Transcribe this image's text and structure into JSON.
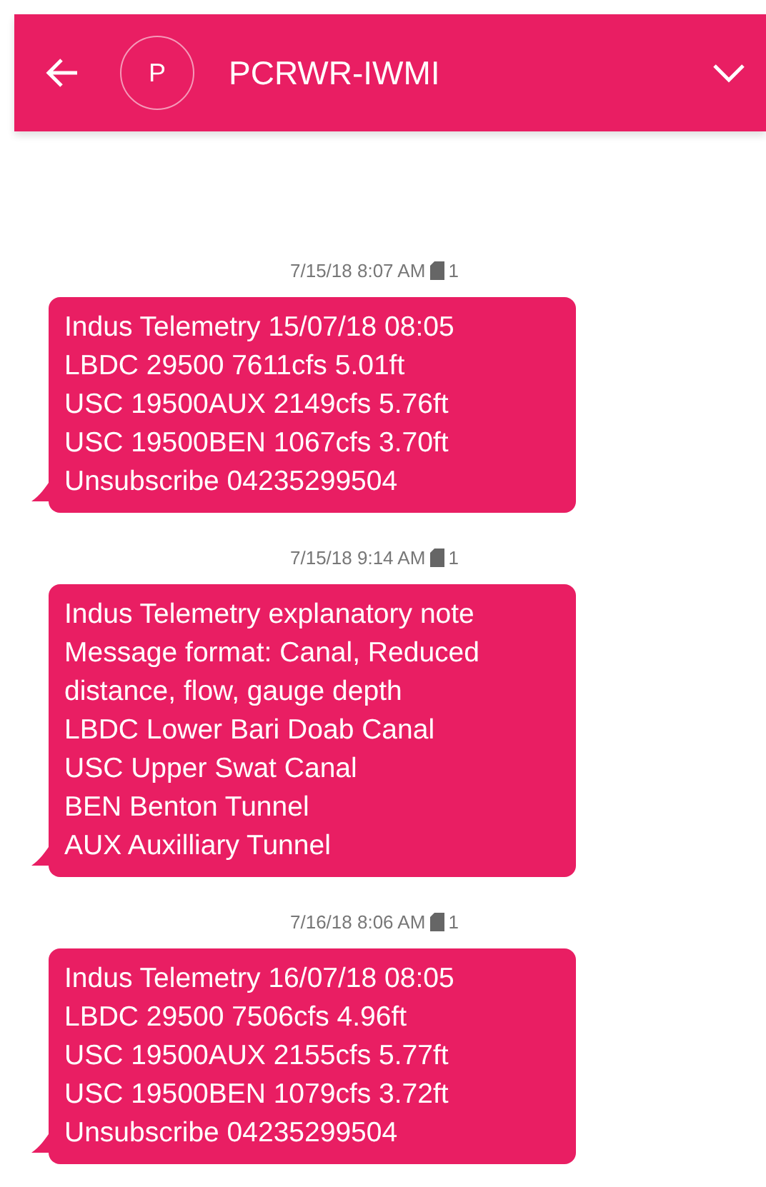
{
  "header": {
    "title": "PCRWR-IWMI",
    "avatar_letter": "P"
  },
  "messages": [
    {
      "timestamp": "7/15/18 8:07 AM",
      "sim": "1",
      "lines": [
        "Indus Telemetry 15/07/18 08:05",
        "LBDC 29500 7611cfs 5.01ft",
        "USC 19500AUX 2149cfs 5.76ft",
        "USC 19500BEN 1067cfs 3.70ft",
        "Unsubscribe 04235299504"
      ]
    },
    {
      "timestamp": "7/15/18 9:14 AM",
      "sim": "1",
      "lines": [
        "Indus Telemetry explanatory note",
        "Message format: Canal, Reduced",
        "distance, flow, gauge depth",
        "LBDC Lower Bari Doab Canal",
        "USC Upper Swat Canal",
        "BEN Benton Tunnel",
        "AUX Auxilliary Tunnel"
      ]
    },
    {
      "timestamp": "7/16/18 8:06 AM",
      "sim": "1",
      "lines": [
        "Indus Telemetry 16/07/18 08:05",
        "LBDC 29500 7506cfs 4.96ft",
        "USC 19500AUX 2155cfs 5.77ft",
        "USC 19500BEN 1079cfs 3.72ft",
        "Unsubscribe 04235299504"
      ]
    }
  ]
}
